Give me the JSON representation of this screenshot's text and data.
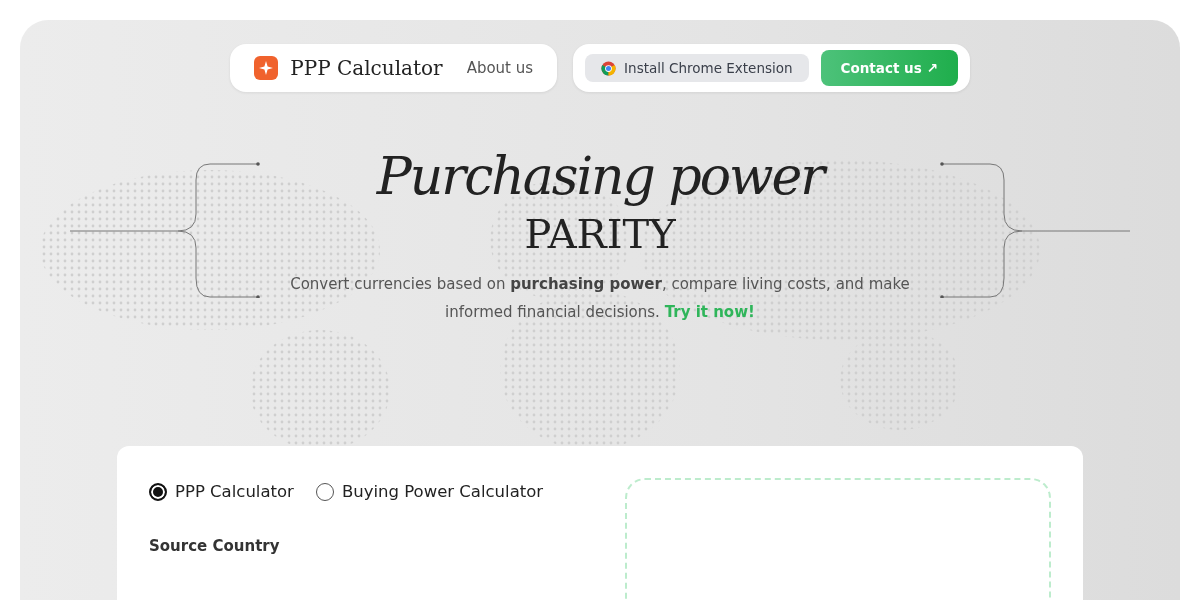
{
  "nav": {
    "brand": "PPP Calculator",
    "links": [
      {
        "label": "About us"
      }
    ],
    "extension_button": "Install Chrome Extension",
    "contact_button": "Contact us ↗"
  },
  "hero": {
    "title_line_1": "Purchasing power",
    "title_line_2": "PARITY",
    "description": "Convert currencies based on **purchasing power**, compare living costs, and make informed financial decisions.",
    "cta_link": "Try it now!"
  },
  "calculator": {
    "modes": [
      {
        "label": "PPP Calculator",
        "selected": true
      },
      {
        "label": "Buying Power Calculator",
        "selected": false
      }
    ],
    "source_country_label": "Source Country"
  }
}
